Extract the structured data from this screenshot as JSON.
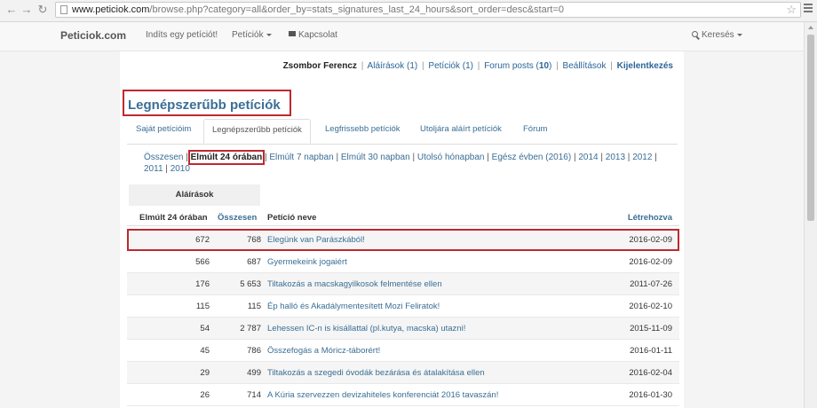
{
  "browser": {
    "url_host": "www.peticiok.com",
    "url_path": "/browse.php?category=all&order_by=stats_signatures_last_24_hours&sort_order=desc&start=0"
  },
  "topnav": {
    "brand": "Peticiok.com",
    "start_petition": "Indíts egy petíciót!",
    "petitions": "Petíciók",
    "contact": "Kapcsolat",
    "search": "Keresés"
  },
  "userbar": {
    "username": "Zsombor Ferencz",
    "signatures_label": "Aláírások",
    "signatures_count": "(1)",
    "petitions_label": "Petíciók",
    "petitions_count": "(1)",
    "forum_label": "Forum posts",
    "forum_count_open": "(",
    "forum_count": "10",
    "forum_count_close": ")",
    "settings": "Beállítások",
    "logout": "Kijelentkezés"
  },
  "page_title": "Legnépszerűbb petíciók",
  "tabs": [
    {
      "label": "Saját petícióim"
    },
    {
      "label": "Legnépszerűbb petíciók"
    },
    {
      "label": "Legfrissebb petíciók"
    },
    {
      "label": "Utoljára aláírt petíciók"
    },
    {
      "label": "Fórum"
    }
  ],
  "filters": {
    "all": "Összesen",
    "last_24h": "Elmúlt 24 órában",
    "last_7d": "Elmúlt 7 napban",
    "last_30d": "Elmúlt 30 napban",
    "last_month": "Utolsó hónapban",
    "whole_year": "Egész évben (2016)",
    "y2014": "2014",
    "y2013": "2013",
    "y2012": "2012",
    "y2011": "2011",
    "y2010": "2010"
  },
  "table": {
    "group_header": "Aláírások",
    "col_24h": "Elmúlt 24 órában",
    "col_total": "Összesen",
    "col_name": "Petíció neve",
    "col_created": "Létrehozva",
    "rows": [
      {
        "last24": "672",
        "total": "768",
        "name": "Elegünk van Parászkából!",
        "created": "2016-02-09"
      },
      {
        "last24": "566",
        "total": "687",
        "name": "Gyermekeink jogaiért",
        "created": "2016-02-09"
      },
      {
        "last24": "176",
        "total": "5 653",
        "name": "Tiltakozás a macskagyilkosok felmentése ellen",
        "created": "2011-07-26"
      },
      {
        "last24": "115",
        "total": "115",
        "name": "Ép halló és Akadálymentesített Mozi Feliratok!",
        "created": "2016-02-10"
      },
      {
        "last24": "54",
        "total": "2 787",
        "name": "Lehessen IC-n is kisállattal (pl.kutya, macska) utazni!",
        "created": "2015-11-09"
      },
      {
        "last24": "45",
        "total": "786",
        "name": "Összefogás a Móricz-táborért!",
        "created": "2016-01-11"
      },
      {
        "last24": "29",
        "total": "499",
        "name": "Tiltakozás a szegedi óvodák bezárása és átalakítása ellen",
        "created": "2016-02-04"
      },
      {
        "last24": "26",
        "total": "714",
        "name": "A Kúria szervezzen devizahiteles konferenciát 2016 tavaszán!",
        "created": "2016-01-30"
      }
    ]
  },
  "colors": {
    "highlight": "#c0282e",
    "link": "#3a6e95"
  }
}
